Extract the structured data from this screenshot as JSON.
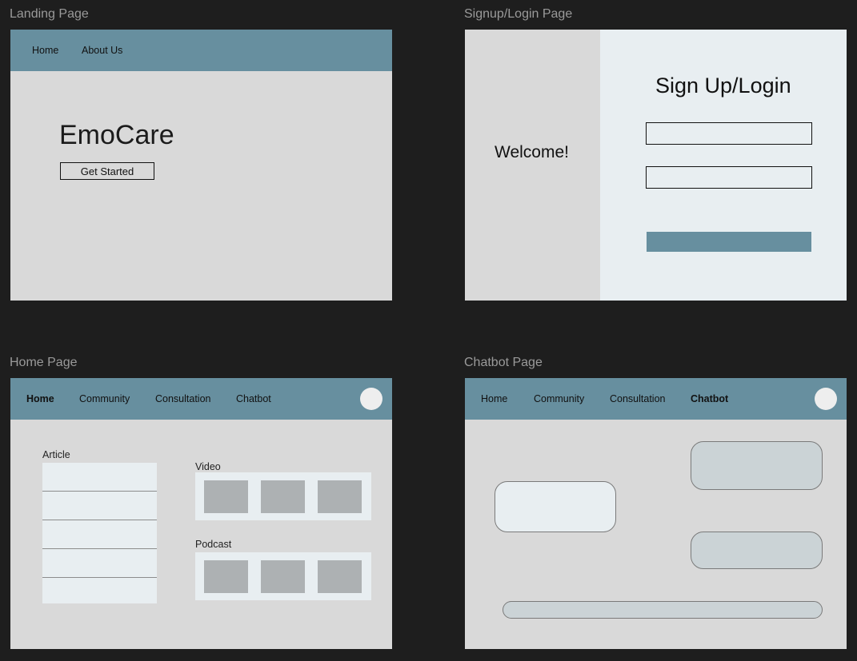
{
  "frames": {
    "landing": {
      "title": "Landing Page"
    },
    "signup": {
      "title": "Signup/Login Page"
    },
    "home": {
      "title": "Home Page"
    },
    "chatbot": {
      "title": "Chatbot Page"
    }
  },
  "landing": {
    "nav": [
      "Home",
      "About Us"
    ],
    "brand": "EmoCare",
    "cta_label": "Get Started"
  },
  "signup": {
    "welcome": "Welcome!",
    "form_title": "Sign Up/Login",
    "field_1_value": "",
    "field_2_value": "",
    "submit_label": ""
  },
  "app_nav": [
    "Home",
    "Community",
    "Consultation",
    "Chatbot"
  ],
  "home": {
    "active_nav": "Home",
    "article_label": "Article",
    "video_label": "Video",
    "podcast_label": "Podcast"
  },
  "chatbot": {
    "active_nav": "Chatbot",
    "input_value": ""
  },
  "colors": {
    "canvas": "#1e1e1e",
    "nav_bar": "#678f9f",
    "frame_bg": "#d9d9d9",
    "panel_light": "#e8eef1",
    "thumbnail": "#adb1b3",
    "user_bubble": "#cbd3d6"
  }
}
